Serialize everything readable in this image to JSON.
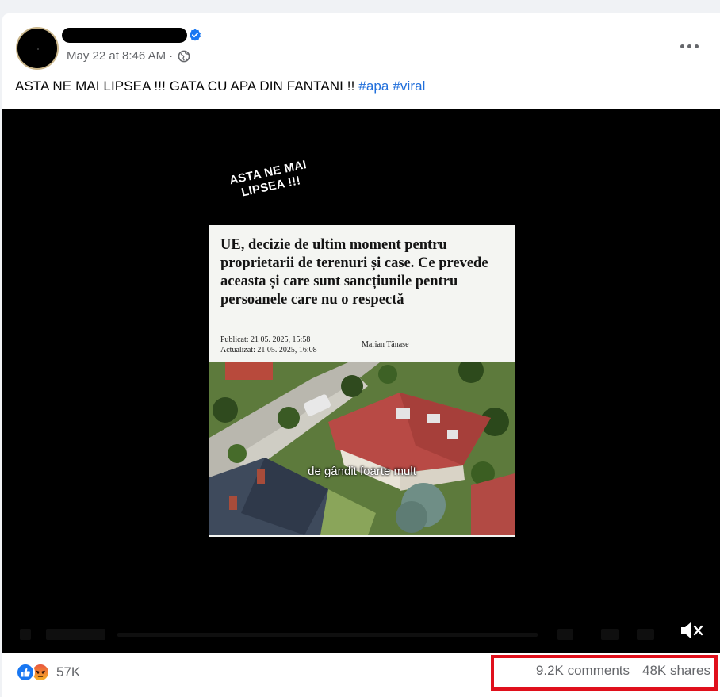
{
  "post": {
    "timestamp": "May 22 at 8:46 AM",
    "separator": "·",
    "privacy_icon": "globe-icon",
    "verified_icon": "verified-badge-icon",
    "more_icon": "more-options-icon",
    "caption_text": "ASTA NE MAI LIPSEA !!! GATA CU APA DIN FANTANI !! ",
    "hashtags": [
      "#apa",
      "#viral"
    ]
  },
  "video": {
    "overlay_line1": "ASTA NE MAI",
    "overlay_line2": "LIPSEA !!!",
    "article": {
      "headline": "UE, decizie de ultim moment pentru proprietarii de terenuri și case. Ce prevede aceasta și care sunt sancțiunile pentru persoanele care nu o respectă",
      "published": "Publicat: 21 05. 2025, 15:58",
      "updated": "Actualizat: 21 05. 2025, 16:08",
      "author": "Marian Tănase"
    },
    "subtitle": "de gândit foarte mult",
    "mute_icon": "volume-muted-icon"
  },
  "footer": {
    "reaction_icons": [
      "like-icon",
      "angry-icon"
    ],
    "reaction_count": "57K",
    "comments": "9.2K comments",
    "shares": "48K shares"
  },
  "colors": {
    "link": "#216fdb",
    "like": "#1877f2",
    "highlight_box": "#e0101c",
    "secondary_text": "#65676b"
  }
}
